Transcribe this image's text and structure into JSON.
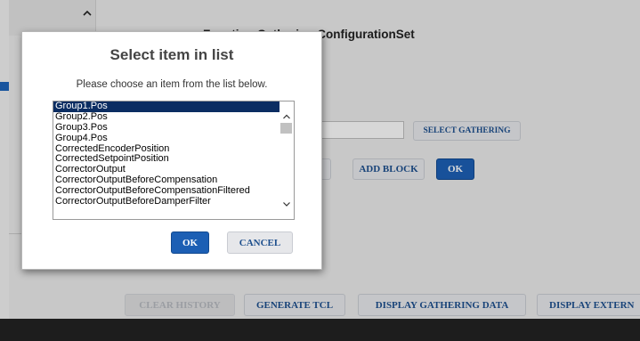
{
  "page": {
    "title": "Function Gathering ConfigurationSet",
    "gathering_input_value": "",
    "buttons": {
      "select_gathering": "SELECT GATHERING",
      "add_block": "ADD BLOCK",
      "ok": "OK",
      "clear_history": "CLEAR HISTORY",
      "generate_tcl": "GENERATE TCL",
      "display_gathering_data": "DISPLAY GATHERING DATA",
      "display_external": "DISPLAY EXTERN"
    }
  },
  "dialog": {
    "title": "Select item in list",
    "subtitle": "Please choose an item from the list below.",
    "items": [
      "Group1.Pos",
      "Group2.Pos",
      "Group3.Pos",
      "Group4.Pos",
      "CorrectedEncoderPosition",
      "CorrectedSetpointPosition",
      "CorrectorOutput",
      "CorrectorOutputBeforeCompensation",
      "CorrectorOutputBeforeCompensationFiltered",
      "CorrectorOutputBeforeDamperFilter"
    ],
    "selected_index": 0,
    "ok_label": "OK",
    "cancel_label": "CANCEL"
  },
  "colors": {
    "accent_blue": "#1c5fb4",
    "selection": "#0b2d62",
    "bottom_bar": "#222222"
  }
}
